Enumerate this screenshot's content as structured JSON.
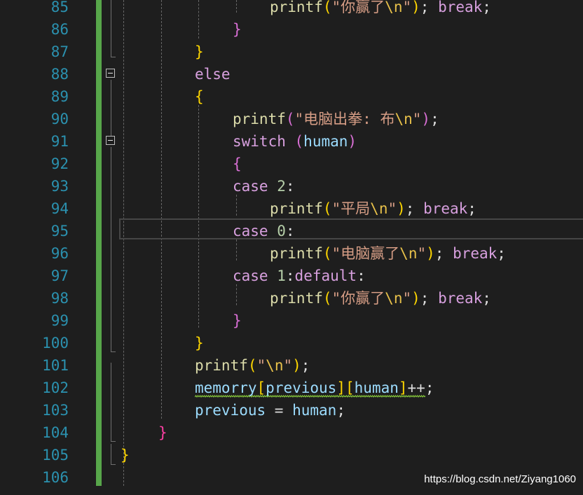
{
  "editor": {
    "line_numbers": [
      "85",
      "86",
      "87",
      "88",
      "89",
      "90",
      "91",
      "92",
      "93",
      "94",
      "95",
      "96",
      "97",
      "98",
      "99",
      "100",
      "101",
      "102",
      "103",
      "104",
      "105",
      "106"
    ],
    "lines": [
      {
        "indent": 385,
        "tokens": [
          {
            "t": "printf",
            "c": "fn"
          },
          {
            "t": "(",
            "c": "b1"
          },
          {
            "t": "\"你赢了",
            "c": "str"
          },
          {
            "t": "\\n",
            "c": "esc"
          },
          {
            "t": "\"",
            "c": "str"
          },
          {
            "t": ")",
            "c": "b1"
          },
          {
            "t": "; ",
            "c": "op"
          },
          {
            "t": "break",
            "c": "kw"
          },
          {
            "t": ";",
            "c": "op"
          }
        ]
      },
      {
        "indent": 332,
        "tokens": [
          {
            "t": "}",
            "c": "b2"
          }
        ]
      },
      {
        "indent": 278,
        "tokens": [
          {
            "t": "}",
            "c": "b1"
          }
        ]
      },
      {
        "indent": 278,
        "tokens": [
          {
            "t": "else",
            "c": "kw"
          }
        ]
      },
      {
        "indent": 278,
        "tokens": [
          {
            "t": "{",
            "c": "b1"
          }
        ]
      },
      {
        "indent": 332,
        "tokens": [
          {
            "t": "printf",
            "c": "fn"
          },
          {
            "t": "(",
            "c": "b2"
          },
          {
            "t": "\"电脑出拳: 布",
            "c": "str"
          },
          {
            "t": "\\n",
            "c": "esc"
          },
          {
            "t": "\"",
            "c": "str"
          },
          {
            "t": ")",
            "c": "b2"
          },
          {
            "t": ";",
            "c": "op"
          }
        ]
      },
      {
        "indent": 332,
        "tokens": [
          {
            "t": "switch",
            "c": "kw"
          },
          {
            "t": " ",
            "c": "op"
          },
          {
            "t": "(",
            "c": "b2"
          },
          {
            "t": "human",
            "c": "var"
          },
          {
            "t": ")",
            "c": "b2"
          }
        ]
      },
      {
        "indent": 332,
        "tokens": [
          {
            "t": "{",
            "c": "b2"
          }
        ]
      },
      {
        "indent": 332,
        "tokens": [
          {
            "t": "case",
            "c": "kw"
          },
          {
            "t": " ",
            "c": "op"
          },
          {
            "t": "2",
            "c": "num"
          },
          {
            "t": ":",
            "c": "op"
          }
        ]
      },
      {
        "indent": 385,
        "tokens": [
          {
            "t": "printf",
            "c": "fn"
          },
          {
            "t": "(",
            "c": "b1"
          },
          {
            "t": "\"平局",
            "c": "str"
          },
          {
            "t": "\\n",
            "c": "esc"
          },
          {
            "t": "\"",
            "c": "str"
          },
          {
            "t": ")",
            "c": "b1"
          },
          {
            "t": "; ",
            "c": "op"
          },
          {
            "t": "break",
            "c": "kw"
          },
          {
            "t": ";",
            "c": "op"
          }
        ]
      },
      {
        "indent": 332,
        "tokens": [
          {
            "t": "case",
            "c": "kw"
          },
          {
            "t": " ",
            "c": "op"
          },
          {
            "t": "0",
            "c": "num"
          },
          {
            "t": ":",
            "c": "op"
          }
        ]
      },
      {
        "indent": 385,
        "tokens": [
          {
            "t": "printf",
            "c": "fn"
          },
          {
            "t": "(",
            "c": "b1"
          },
          {
            "t": "\"电脑赢了",
            "c": "str"
          },
          {
            "t": "\\n",
            "c": "esc"
          },
          {
            "t": "\"",
            "c": "str"
          },
          {
            "t": ")",
            "c": "b1"
          },
          {
            "t": "; ",
            "c": "op"
          },
          {
            "t": "break",
            "c": "kw"
          },
          {
            "t": ";",
            "c": "op"
          }
        ]
      },
      {
        "indent": 332,
        "tokens": [
          {
            "t": "case",
            "c": "kw"
          },
          {
            "t": " ",
            "c": "op"
          },
          {
            "t": "1",
            "c": "num"
          },
          {
            "t": ":",
            "c": "op"
          },
          {
            "t": "default",
            "c": "kw"
          },
          {
            "t": ":",
            "c": "op"
          }
        ]
      },
      {
        "indent": 385,
        "tokens": [
          {
            "t": "printf",
            "c": "fn"
          },
          {
            "t": "(",
            "c": "b1"
          },
          {
            "t": "\"你赢了",
            "c": "str"
          },
          {
            "t": "\\n",
            "c": "esc"
          },
          {
            "t": "\"",
            "c": "str"
          },
          {
            "t": ")",
            "c": "b1"
          },
          {
            "t": "; ",
            "c": "op"
          },
          {
            "t": "break",
            "c": "kw"
          },
          {
            "t": ";",
            "c": "op"
          }
        ]
      },
      {
        "indent": 332,
        "tokens": [
          {
            "t": "}",
            "c": "b2"
          }
        ]
      },
      {
        "indent": 278,
        "tokens": [
          {
            "t": "}",
            "c": "b1"
          }
        ]
      },
      {
        "indent": 278,
        "tokens": [
          {
            "t": "printf",
            "c": "fn"
          },
          {
            "t": "(",
            "c": "b1"
          },
          {
            "t": "\"",
            "c": "str"
          },
          {
            "t": "\\n",
            "c": "esc"
          },
          {
            "t": "\"",
            "c": "str"
          },
          {
            "t": ")",
            "c": "b1"
          },
          {
            "t": ";",
            "c": "op"
          }
        ]
      },
      {
        "indent": 278,
        "tokens": [
          {
            "t": "memorry",
            "c": "var",
            "sq": true
          },
          {
            "t": "[",
            "c": "b1",
            "sq": true
          },
          {
            "t": "previous",
            "c": "var",
            "sq": true
          },
          {
            "t": "]",
            "c": "b1",
            "sq": true
          },
          {
            "t": "[",
            "c": "b1",
            "sq": true
          },
          {
            "t": "human",
            "c": "var",
            "sq": true
          },
          {
            "t": "]",
            "c": "b1",
            "sq": true
          },
          {
            "t": "++",
            "c": "op",
            "sq": true
          },
          {
            "t": ";",
            "c": "op"
          }
        ]
      },
      {
        "indent": 278,
        "tokens": [
          {
            "t": "previous",
            "c": "var"
          },
          {
            "t": " = ",
            "c": "op"
          },
          {
            "t": "human",
            "c": "var"
          },
          {
            "t": ";",
            "c": "op"
          }
        ]
      },
      {
        "indent": 226,
        "tokens": [
          {
            "t": "}",
            "c": "b4"
          }
        ]
      },
      {
        "indent": 172,
        "tokens": [
          {
            "t": "}",
            "c": "b1"
          }
        ]
      },
      {
        "indent": 0,
        "tokens": []
      }
    ]
  },
  "watermark": {
    "text": "https://blog.csdn.net/Ziyang1060"
  },
  "icons": {
    "fold": "collapse-region-icon"
  },
  "colors": {
    "background": "#1e1e1e",
    "line_number": "#2b91af",
    "change_bar": "#57a64a"
  }
}
